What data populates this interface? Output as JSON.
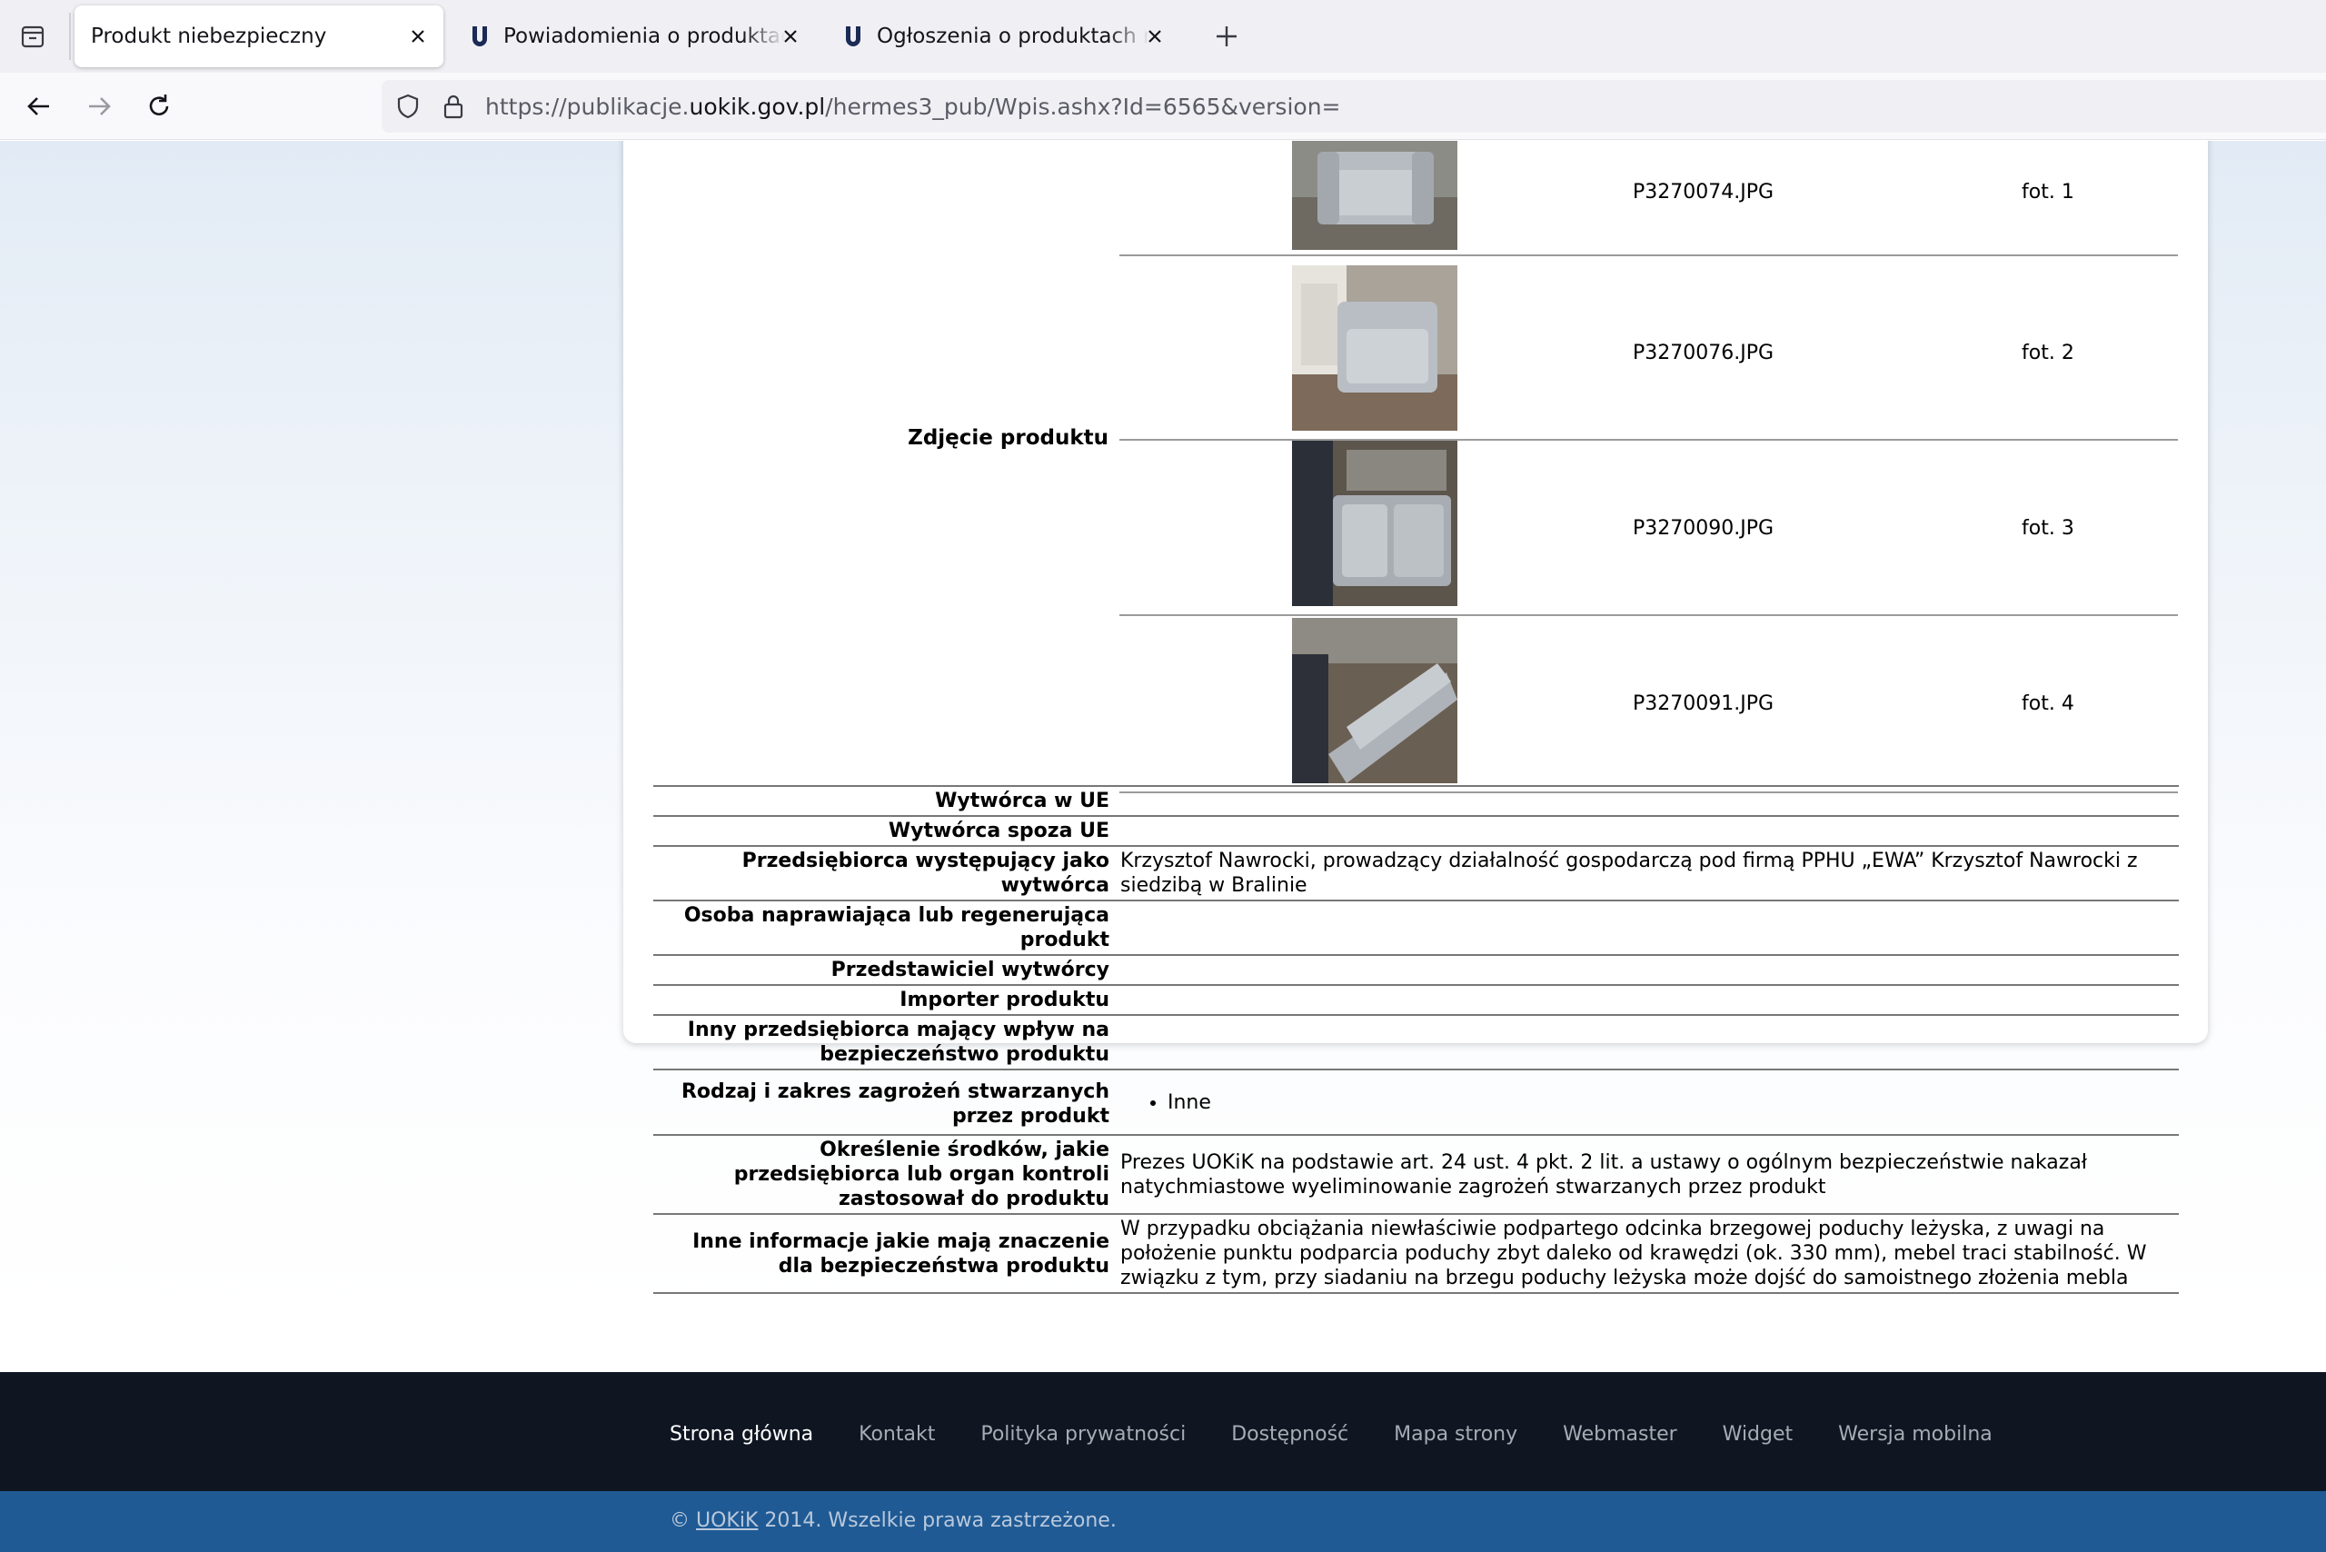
{
  "browser": {
    "tabs": [
      {
        "title": "Produkt niebezpieczny",
        "active": true
      },
      {
        "title": "Powiadomienia o produktach niebezpiecznych",
        "active": false
      },
      {
        "title": "Ogłoszenia o produktach niebezpiecznych",
        "active": false
      }
    ],
    "url": {
      "prefix": "https://publikacje.",
      "host": "uokik.gov.pl",
      "path": "/hermes3_pub/Wpis.ashx?Id=6565&version="
    }
  },
  "photo_section": {
    "label": "Zdjęcie produktu",
    "photos": [
      {
        "file": "P3270074.JPG",
        "caption": "fot. 1"
      },
      {
        "file": "P3270076.JPG",
        "caption": "fot. 2"
      },
      {
        "file": "P3270090.JPG",
        "caption": "fot. 3"
      },
      {
        "file": "P3270091.JPG",
        "caption": "fot. 4"
      }
    ]
  },
  "details": {
    "manufacturer_eu": {
      "label": "Wytwórca w UE",
      "value": ""
    },
    "manufacturer_non_eu": {
      "label": "Wytwórca spoza UE",
      "value": ""
    },
    "acting_manufacturer": {
      "label": "Przedsiębiorca występujący jako wytwórca",
      "value": "Krzysztof Nawrocki, prowadzący działalność gospodarczą pod firmą PPHU „EWA” Krzysztof Nawrocki z siedzibą w Bralinie"
    },
    "repairer": {
      "label": "Osoba naprawiająca lub regenerująca produkt",
      "value": ""
    },
    "representative": {
      "label": "Przedstawiciel wytwórcy",
      "value": ""
    },
    "importer": {
      "label": "Importer produktu",
      "value": ""
    },
    "other_entity": {
      "label": "Inny przedsiębiorca mający wpływ na bezpieczeństwo produktu",
      "value": ""
    },
    "hazards": {
      "label": "Rodzaj i zakres zagrożeń stwarzanych przez produkt",
      "items": [
        "Inne"
      ]
    },
    "measures": {
      "label": "Określenie środków, jakie przedsiębiorca lub organ kontroli zastosował do produktu",
      "value": "Prezes UOKiK na podstawie art. 24 ust. 4 pkt. 2 lit. a ustawy o ogólnym bezpieczeństwie nakazał natychmiastowe wyeliminowanie zagrożeń stwarzanych przez produkt"
    },
    "other_info": {
      "label": "Inne informacje jakie mają znaczenie dla bezpieczeństwa produktu",
      "value": "W przypadku obciążania niewłaściwie podpartego odcinka brzegowej poduchy leżyska, z uwagi na położenie punktu podparcia poduchy zbyt daleko od krawędzi (ok. 330 mm), mebel traci stabilność. W związku z tym, przy siadaniu na brzegu poduchy leżyska może dojść do samoistnego złożenia mebla"
    }
  },
  "footer": {
    "links": [
      "Strona główna",
      "Kontakt",
      "Polityka prywatności",
      "Dostępność",
      "Mapa strony",
      "Webmaster",
      "Widget",
      "Wersja mobilna"
    ],
    "copyright_prefix": "© ",
    "copyright_link": "UOKiK",
    "copyright_suffix": " 2014. Wszelkie prawa zastrzeżone."
  },
  "colors": {
    "footer_bg": "#0f1622",
    "copyright_bg": "#1f5a94",
    "uokik_favicon": "#1c2a56"
  }
}
